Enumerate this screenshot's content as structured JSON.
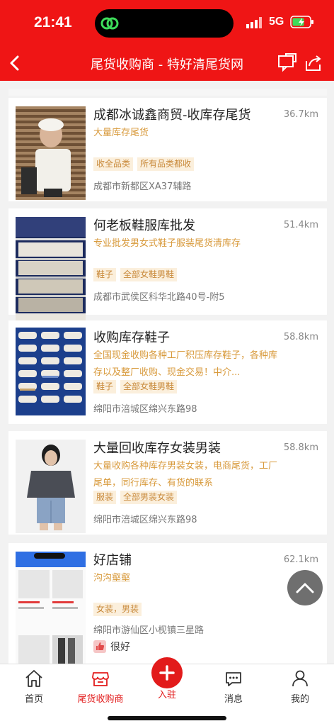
{
  "status_bar": {
    "time": "21:41",
    "network": "5G"
  },
  "nav": {
    "title": "尾货收购商 - 特好清尾货网"
  },
  "merchants": [
    {
      "title": "成都冰诚鑫商贸-收库存尾货",
      "distance": "36.7km",
      "description": "大量库存尾货",
      "tags": [
        "收全品类",
        "所有品类都收"
      ],
      "address": "成都市新都区XA37辅路"
    },
    {
      "title": "何老板鞋服库批发",
      "distance": "51.4km",
      "description": "专业批发男女式鞋子服装尾货清库存",
      "tags": [
        "鞋子",
        "全部女鞋男鞋"
      ],
      "address": "成都市武侯区科华北路40号-附5"
    },
    {
      "title": "收购库存鞋子",
      "distance": "58.8km",
      "description": "全国现金收购各种工厂积压库存鞋子，各种库存以及整厂收购、现金交易！中介...",
      "tags": [
        "鞋子",
        "全部女鞋男鞋"
      ],
      "address": "绵阳市涪城区绵兴东路98"
    },
    {
      "title": "大量回收库存女装男装",
      "distance": "58.8km",
      "description": "大量收购各种库存男装女装，电商尾货，工厂尾单，同行库存、有货的联系",
      "tags": [
        "服装",
        "全部男装女装"
      ],
      "address": "绵阳市涪城区绵兴东路98"
    },
    {
      "title": "好店铺",
      "distance": "62.1km",
      "description": "沟沟壑壑",
      "tags": [
        "女装，男装"
      ],
      "address": "绵阳市游仙区小枧镇三星路",
      "rating": "很好"
    }
  ],
  "tabs": [
    {
      "label": "首页",
      "icon": "home-icon"
    },
    {
      "label": "尾货收购商",
      "icon": "store-icon"
    },
    {
      "label": "入驻",
      "icon": "plus-icon"
    },
    {
      "label": "消息",
      "icon": "message-icon"
    },
    {
      "label": "我的",
      "icon": "user-icon"
    }
  ],
  "colors": {
    "brand_red": "#ef1515",
    "tag_text": "#c8893a",
    "tag_bg": "#fbefdc",
    "desc_text": "#d89a3c"
  }
}
